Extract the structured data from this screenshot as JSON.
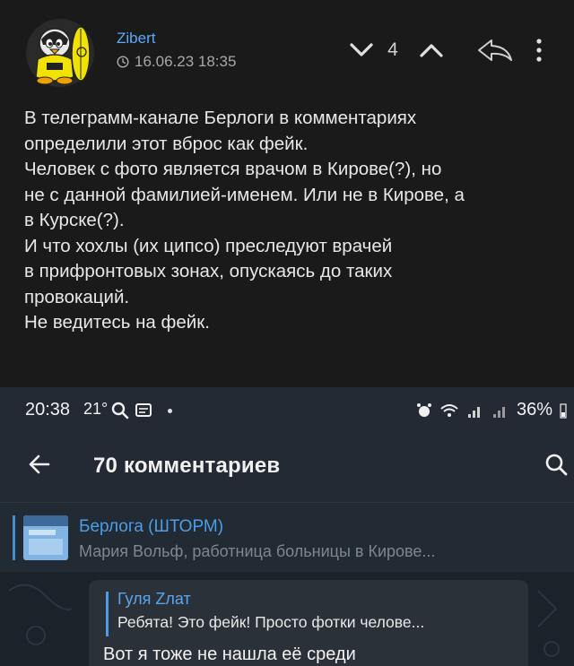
{
  "comment": {
    "username": "Zibert",
    "date": "16.06.23 18:35",
    "vote_count": "4",
    "body_lines": [
      "В телеграмм-канале Берлоги в комментариях",
      "определили этот вброс как фейк.",
      "Человек с фото является врачом в Кирове(?), но",
      "не с данной фамилией-именем. Или не в Кирове, а",
      "в Курске(?).",
      "И что хохлы (их ципсо) преследуют врачей",
      "в прифронтовых зонах, опускаясь до таких",
      "провокаций.",
      "Не ведитесь на фейк."
    ],
    "icons": {
      "avatar": "penguin-surfer-avatar",
      "clock": "clock-icon",
      "down": "chevron-down-icon",
      "up": "chevron-up-icon",
      "reply": "reply-icon",
      "more": "more-vertical-icon"
    }
  },
  "screenshot": {
    "status_bar": {
      "time": "20:38",
      "temperature": "21°",
      "battery": "36%"
    },
    "app_bar": {
      "title": "70 комментариев"
    },
    "pinned": {
      "title": "Берлога (ШТОРМ)",
      "subtitle": "Мария Вольф, работница больницы в Кирове..."
    },
    "message": {
      "quote_author": "Гуля Zлат",
      "quote_text": "Ребята! Это фейк! Просто фотки челове...",
      "text": "Вот я тоже не нашла её среди"
    },
    "colors": {
      "accent": "#4d9de8",
      "panel": "#232a33"
    }
  }
}
